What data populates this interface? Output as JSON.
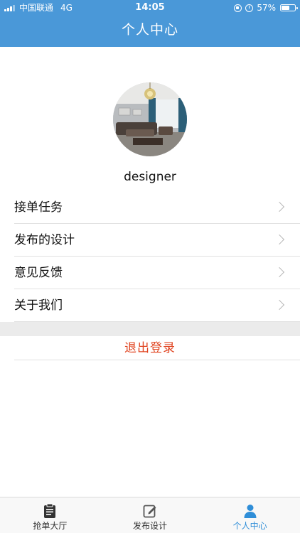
{
  "status_bar": {
    "carrier": "中国联通",
    "network": "4G",
    "time": "14:05",
    "battery": "57%"
  },
  "header": {
    "title": "个人中心",
    "background_color": "#4a98d8"
  },
  "profile": {
    "username": "designer"
  },
  "menu": {
    "items": [
      {
        "label": "接单任务"
      },
      {
        "label": "发布的设计"
      },
      {
        "label": "意见反馈"
      },
      {
        "label": "关于我们"
      }
    ]
  },
  "logout": {
    "label": "退出登录",
    "color": "#e0431f"
  },
  "tabbar": {
    "tabs": [
      {
        "label": "抢单大厅",
        "icon": "clipboard-icon"
      },
      {
        "label": "发布设计",
        "icon": "edit-icon"
      },
      {
        "label": "个人中心",
        "icon": "person-icon"
      }
    ],
    "active_color": "#2f8ed8"
  }
}
